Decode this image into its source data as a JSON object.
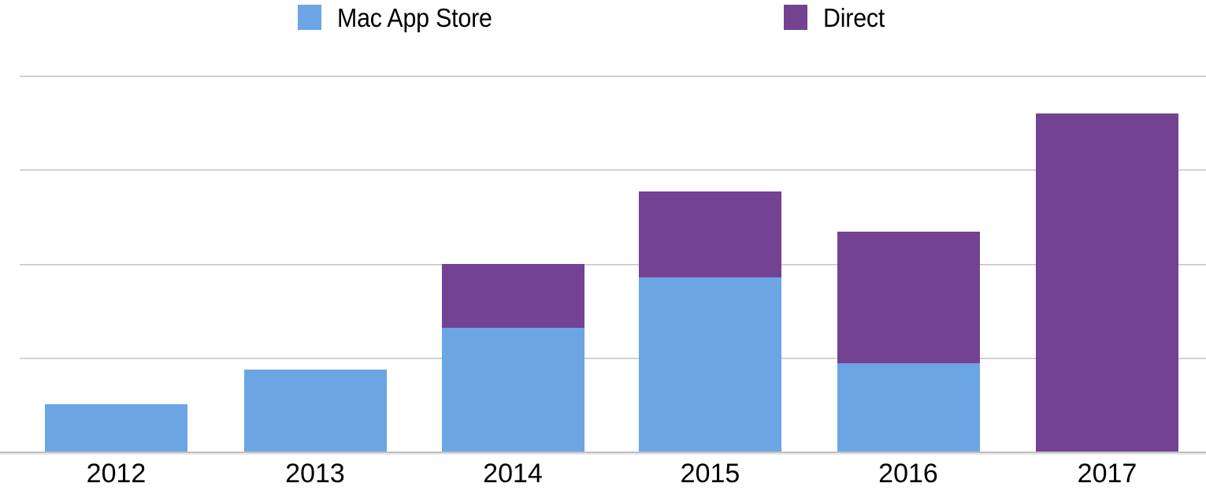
{
  "legend": {
    "position": "top",
    "entries": [
      {
        "label": "Mac App Store",
        "key": "mas",
        "color": "#6ca5e3",
        "icon": "legend-swatch-icon"
      },
      {
        "label": "Direct",
        "key": "direct",
        "color": "#734293",
        "icon": "legend-swatch-icon"
      }
    ]
  },
  "chart_data": {
    "type": "bar",
    "subtype": "stacked-vertical",
    "title": "",
    "subtitle": "",
    "xlabel": "",
    "ylabel": "",
    "categories": [
      "2012",
      "2013",
      "2014",
      "2015",
      "2016",
      "2017"
    ],
    "series": [
      {
        "name": "Mac App Store",
        "color": "#6ca5e3",
        "values": [
          0.5,
          0.87,
          1.32,
          1.85,
          0.94,
          0.0
        ]
      },
      {
        "name": "Direct",
        "color": "#734293",
        "values": [
          0.0,
          0.0,
          0.68,
          0.92,
          1.4,
          3.6
        ]
      }
    ],
    "totals": [
      0.5,
      0.87,
      2.0,
      2.77,
      2.34,
      3.6
    ],
    "ylim": [
      0,
      4
    ],
    "gridlines": [
      1,
      2,
      3,
      4
    ],
    "grid": true,
    "y_tick_labels": [],
    "annotations": []
  },
  "axis": {
    "tick_labels": [
      "2012",
      "2013",
      "2014",
      "2015",
      "2016",
      "2017"
    ],
    "baseline_color": "#c0c0c0",
    "gridline_color": "#c8c8c8"
  },
  "colors": {
    "mac_app_store": "#6ca5e3",
    "direct": "#734293",
    "background": "#ffffff",
    "text": "#000000",
    "gridline": "#c8c8c8"
  }
}
